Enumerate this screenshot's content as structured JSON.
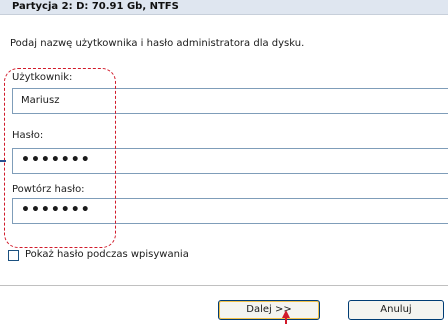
{
  "window": {
    "title": "Partycja 2: D: 70.91 Gb, NTFS"
  },
  "form": {
    "intro": "Podaj nazwę użytkownika i hasło administratora dla dysku.",
    "username_label": "Użytkownik:",
    "username_value": "Mariusz",
    "password_label": "Hasło:",
    "password_value": "•••••••",
    "confirm_label": "Powtórz hasło:",
    "confirm_value": "•••••••",
    "show_password_label": "Pokaż hasło podczas wpisywania",
    "show_password_checked": false
  },
  "buttons": {
    "next_label": "Dalej >>",
    "cancel_label": "Anuluj"
  },
  "colors": {
    "highlight": "#d11a2a",
    "header_bg": "#dfe6f0"
  }
}
